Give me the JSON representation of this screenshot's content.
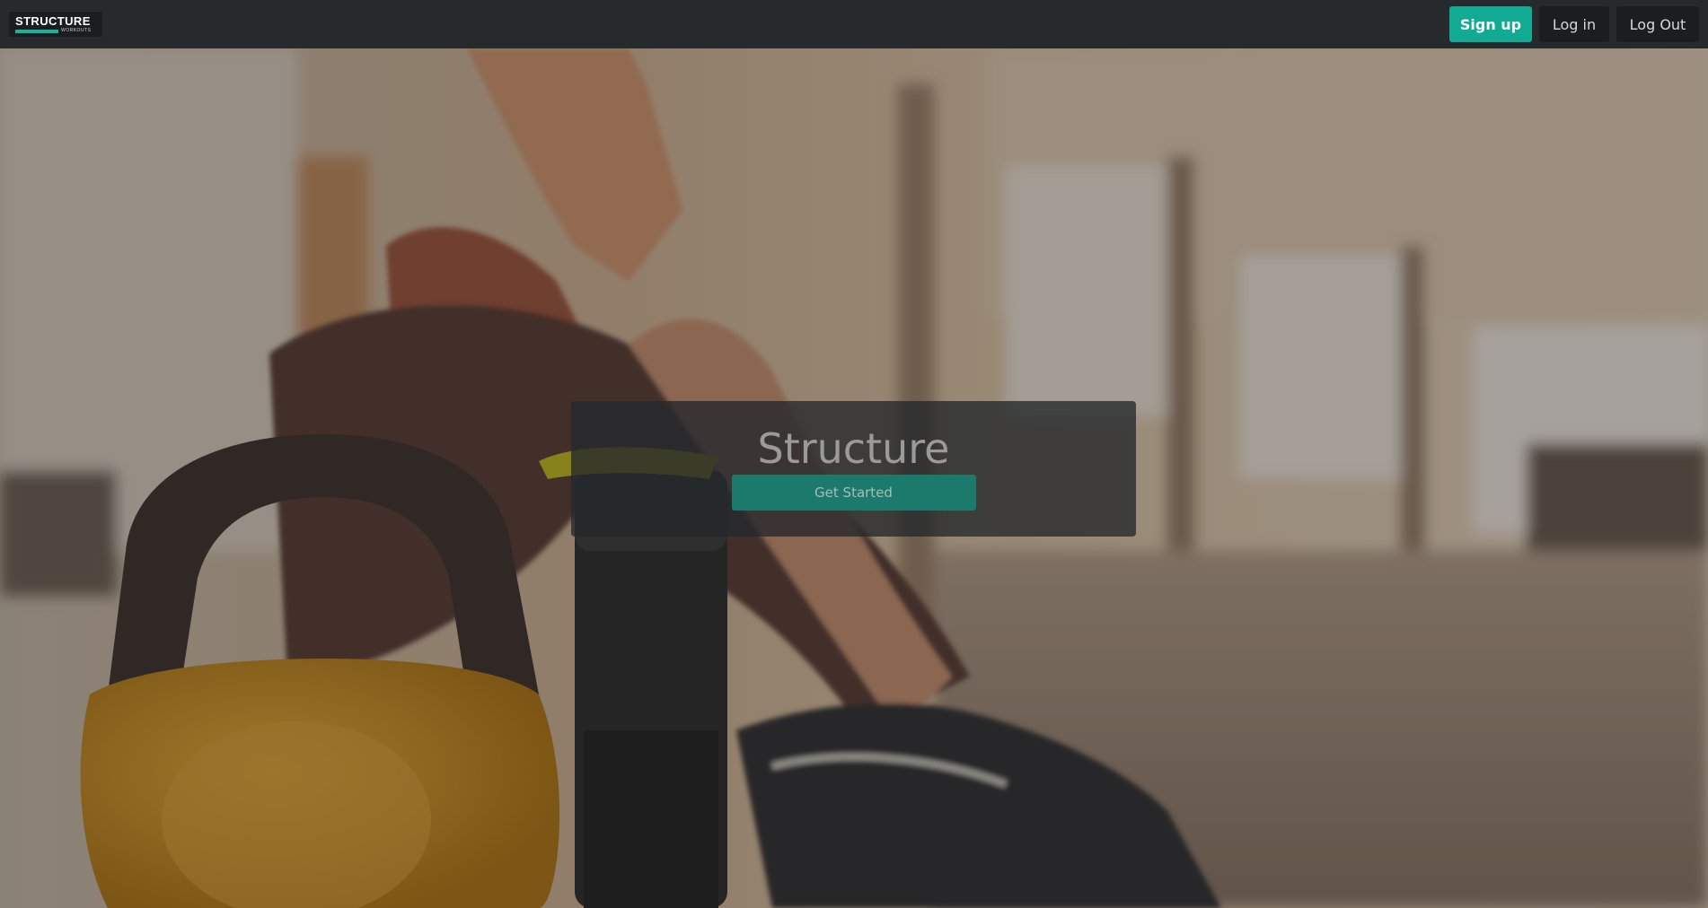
{
  "brand": {
    "logo_text": "STRUCTURE",
    "logo_subtext": "WORKOUTS",
    "accent_color": "#17b49c"
  },
  "nav": {
    "signup_label": "Sign up",
    "login_label": "Log in",
    "logout_label": "Log Out"
  },
  "hero": {
    "title": "Structure",
    "cta_label": "Get Started"
  }
}
